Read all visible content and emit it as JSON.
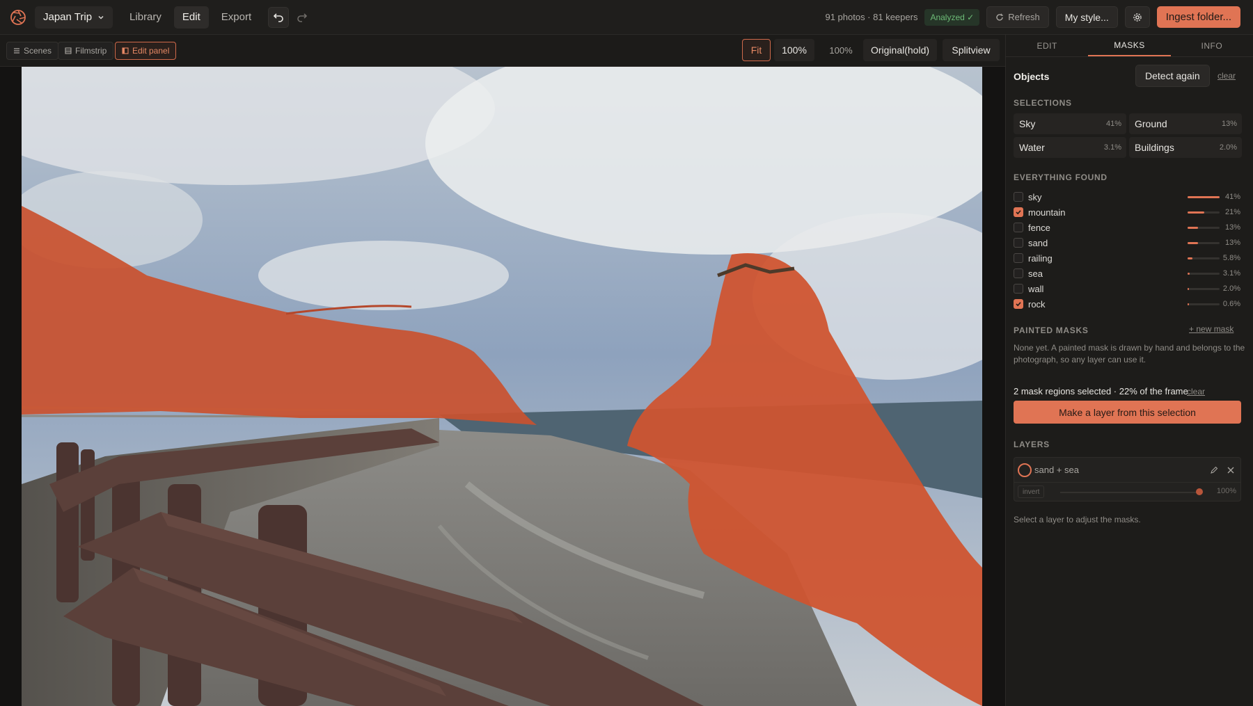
{
  "topbar": {
    "project": "Japan Trip",
    "nav": [
      "Library",
      "Edit",
      "Export"
    ],
    "active_nav": "Edit",
    "stats": "91 photos · 81 keepers",
    "analyzed": "Analyzed ✓",
    "refresh": "Refresh",
    "style": "My style...",
    "ingest": "Ingest folder..."
  },
  "toolbar": {
    "scenes": "Scenes",
    "filmstrip": "Filmstrip",
    "edit_panel": "Edit panel",
    "fit": "Fit",
    "zoom_100": "100%",
    "zoom_readout": "100%",
    "original": "Original(hold)",
    "splitview": "Splitview"
  },
  "panel": {
    "tabs": [
      "EDIT",
      "MASKS",
      "INFO"
    ],
    "active_tab": "MASKS",
    "objects": "Objects",
    "detect_again": "Detect again",
    "clear": "clear",
    "selections_title": "SELECTIONS",
    "selections": [
      {
        "name": "Sky",
        "pct": "41%"
      },
      {
        "name": "Ground",
        "pct": "13%"
      },
      {
        "name": "Water",
        "pct": "3.1%"
      },
      {
        "name": "Buildings",
        "pct": "2.0%"
      }
    ],
    "found_title": "EVERYTHING FOUND",
    "found": [
      {
        "label": "sky",
        "pct": "41%",
        "value": 41,
        "checked": false
      },
      {
        "label": "mountain",
        "pct": "21%",
        "value": 21,
        "checked": true
      },
      {
        "label": "fence",
        "pct": "13%",
        "value": 13,
        "checked": false
      },
      {
        "label": "sand",
        "pct": "13%",
        "value": 13,
        "checked": false
      },
      {
        "label": "railing",
        "pct": "5.8%",
        "value": 5.8,
        "checked": false
      },
      {
        "label": "sea",
        "pct": "3.1%",
        "value": 3.1,
        "checked": false
      },
      {
        "label": "wall",
        "pct": "2.0%",
        "value": 2.0,
        "checked": false
      },
      {
        "label": "rock",
        "pct": "0.6%",
        "value": 0.6,
        "checked": true
      }
    ],
    "painted_title": "PAINTED MASKS",
    "new_mask": "+ new mask",
    "painted_note": "None yet. A painted mask is drawn by hand and belongs to the photograph, so any layer can use it.",
    "selection_summary": "2 mask regions selected · 22% of the frame",
    "clear_selection": "clear",
    "make_layer": "Make a layer from this selection",
    "layers_title": "LAYERS",
    "layer": {
      "name": "sand + sea",
      "invert": "invert",
      "opacity": "100%",
      "opacity_value": 100
    },
    "hint": "Select a layer to adjust the masks."
  },
  "colors": {
    "accent": "#e07454",
    "mask_overlay": "#d05a34",
    "analyzed_green": "#6dbb77"
  },
  "icons": [
    "aperture-logo-icon",
    "chevron-down-icon",
    "undo-icon",
    "redo-icon",
    "refresh-icon",
    "gear-icon",
    "scenes-icon",
    "filmstrip-icon",
    "panel-icon",
    "pencil-icon",
    "close-icon",
    "check-icon"
  ]
}
